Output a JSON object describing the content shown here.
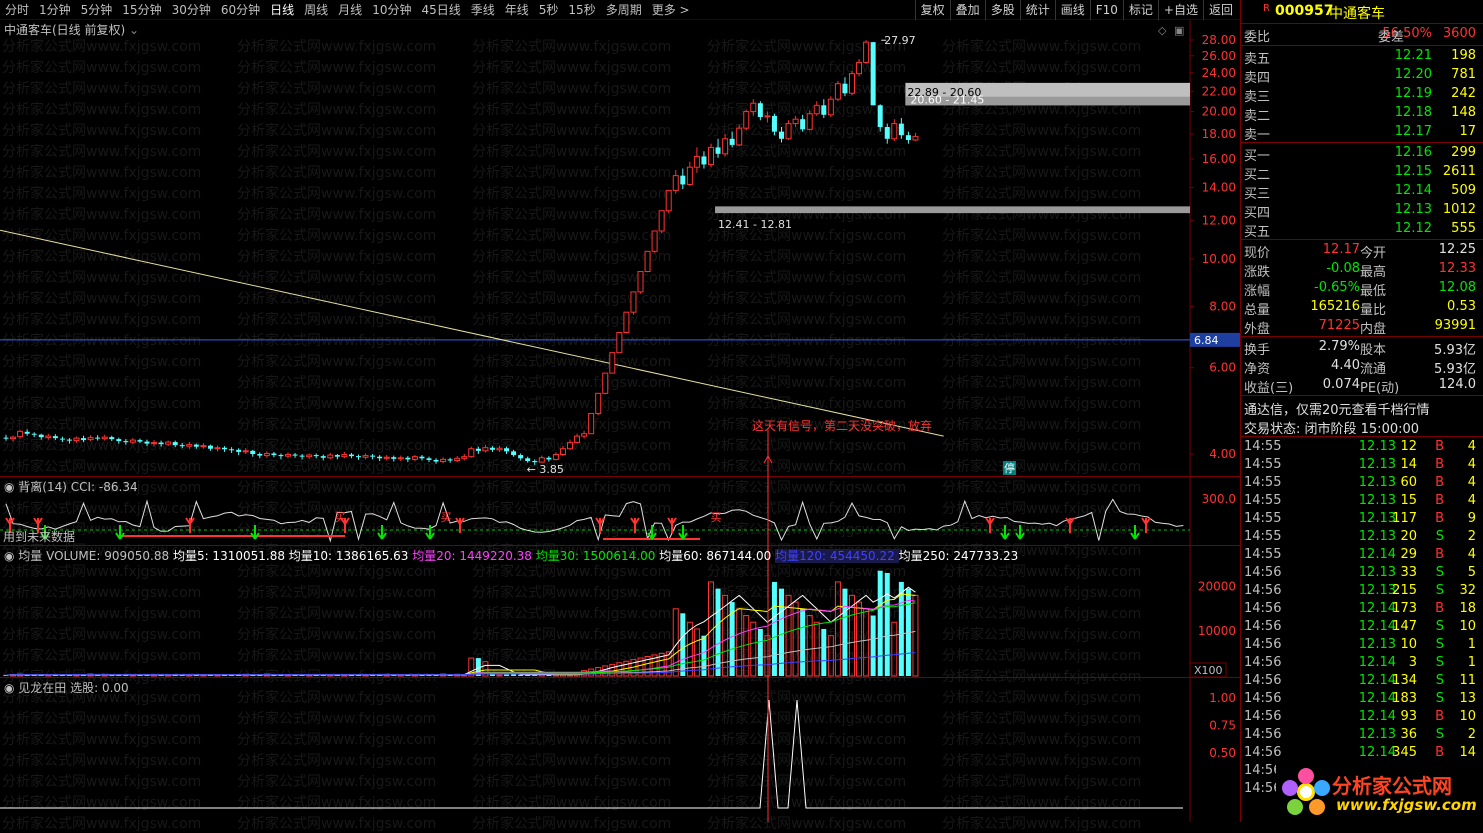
{
  "toolbar": {
    "periods": [
      "分时",
      "1分钟",
      "5分钟",
      "15分钟",
      "30分钟",
      "60分钟",
      "日线",
      "周线",
      "月线",
      "10分钟",
      "45日线",
      "季线",
      "年线",
      "5秒",
      "15秒",
      "多周期",
      "更多 >"
    ],
    "active_period": "日线",
    "tools": [
      "复权",
      "叠加",
      "多股",
      "统计",
      "画线",
      "F10",
      "标记",
      "+自选",
      "返回"
    ]
  },
  "main_chart": {
    "title": "中通客车(日线 前复权)",
    "y_axis": [
      "28.00",
      "26.00",
      "24.00",
      "22.00",
      "20.00",
      "18.00",
      "16.00",
      "14.00",
      "12.00",
      "10.00",
      "8.00",
      "6.00",
      "4.00"
    ],
    "current_price_tag": "6.84",
    "high_label": "27.97",
    "low_label": "3.85",
    "zone_upper_1": "22.89 - 20.60",
    "zone_upper_2": "20.60 - 21.45",
    "zone_lower": "12.41 - 12.81",
    "signal_note": "这天有信号，第二天没突破，放弃",
    "limit_badge": "停",
    "candles": [
      [
        4.32,
        4.3,
        4.38,
        4.26
      ],
      [
        4.3,
        4.33,
        4.36,
        4.24
      ],
      [
        4.34,
        4.45,
        4.48,
        4.3
      ],
      [
        4.44,
        4.4,
        4.49,
        4.36
      ],
      [
        4.4,
        4.38,
        4.43,
        4.33
      ],
      [
        4.38,
        4.33,
        4.4,
        4.28
      ],
      [
        4.32,
        4.35,
        4.4,
        4.28
      ],
      [
        4.35,
        4.31,
        4.39,
        4.27
      ],
      [
        4.3,
        4.28,
        4.34,
        4.23
      ],
      [
        4.28,
        4.26,
        4.31,
        4.2
      ],
      [
        4.26,
        4.31,
        4.34,
        4.22
      ],
      [
        4.31,
        4.27,
        4.36,
        4.23
      ],
      [
        4.28,
        4.32,
        4.37,
        4.25
      ],
      [
        4.32,
        4.3,
        4.37,
        4.26
      ],
      [
        4.3,
        4.33,
        4.38,
        4.26
      ],
      [
        4.33,
        4.29,
        4.36,
        4.25
      ],
      [
        4.29,
        4.25,
        4.32,
        4.2
      ],
      [
        4.25,
        4.23,
        4.29,
        4.18
      ],
      [
        4.23,
        4.27,
        4.31,
        4.19
      ],
      [
        4.27,
        4.24,
        4.3,
        4.21
      ],
      [
        4.24,
        4.2,
        4.28,
        4.15
      ],
      [
        4.2,
        4.22,
        4.27,
        4.15
      ],
      [
        4.22,
        4.19,
        4.26,
        4.14
      ],
      [
        4.19,
        4.23,
        4.26,
        4.15
      ],
      [
        4.23,
        4.17,
        4.26,
        4.13
      ],
      [
        4.17,
        4.15,
        4.21,
        4.11
      ],
      [
        4.15,
        4.18,
        4.23,
        4.1
      ],
      [
        4.18,
        4.14,
        4.2,
        4.1
      ],
      [
        4.14,
        4.16,
        4.21,
        4.1
      ],
      [
        4.16,
        4.1,
        4.18,
        4.06
      ],
      [
        4.1,
        4.12,
        4.16,
        4.05
      ],
      [
        4.12,
        4.09,
        4.15,
        4.04
      ],
      [
        4.09,
        4.08,
        4.13,
        4.02
      ],
      [
        4.08,
        4.04,
        4.11,
        3.98
      ],
      [
        4.04,
        4.06,
        4.11,
        4.0
      ],
      [
        4.06,
        4.0,
        4.08,
        3.95
      ],
      [
        4.0,
        3.97,
        4.03,
        3.92
      ],
      [
        3.97,
        4.01,
        4.05,
        3.93
      ],
      [
        4.01,
        3.98,
        4.04,
        3.94
      ],
      [
        3.98,
        3.96,
        4.01,
        3.9
      ],
      [
        3.96,
        3.99,
        4.03,
        3.92
      ],
      [
        3.99,
        3.97,
        4.02,
        3.93
      ],
      [
        3.97,
        3.95,
        4.0,
        3.9
      ],
      [
        3.95,
        3.98,
        4.01,
        3.91
      ],
      [
        3.98,
        3.96,
        4.01,
        3.92
      ],
      [
        3.96,
        3.93,
        3.99,
        3.88
      ],
      [
        3.93,
        3.98,
        4.02,
        3.9
      ],
      [
        3.98,
        3.95,
        4.0,
        3.9
      ],
      [
        3.95,
        3.99,
        4.04,
        3.92
      ],
      [
        3.99,
        3.96,
        4.02,
        3.92
      ],
      [
        3.96,
        3.94,
        3.99,
        3.89
      ],
      [
        3.94,
        3.97,
        4.01,
        3.9
      ],
      [
        3.97,
        3.95,
        4.0,
        3.9
      ],
      [
        3.95,
        3.92,
        3.98,
        3.87
      ],
      [
        3.92,
        3.94,
        3.98,
        3.88
      ],
      [
        3.94,
        3.91,
        3.97,
        3.86
      ],
      [
        3.91,
        3.93,
        3.97,
        3.87
      ],
      [
        3.93,
        3.9,
        3.96,
        3.85
      ],
      [
        3.9,
        3.95,
        3.98,
        3.87
      ],
      [
        3.95,
        3.92,
        3.98,
        3.88
      ],
      [
        3.92,
        3.89,
        3.95,
        3.85
      ],
      [
        3.89,
        3.86,
        3.92,
        3.82
      ],
      [
        3.86,
        3.9,
        3.94,
        3.83
      ],
      [
        3.9,
        3.88,
        3.93,
        3.84
      ],
      [
        3.88,
        3.92,
        3.96,
        3.85
      ],
      [
        3.92,
        3.95,
        4.0,
        3.88
      ],
      [
        3.95,
        4.1,
        4.14,
        3.93
      ],
      [
        4.1,
        4.06,
        4.14,
        4.0
      ],
      [
        4.06,
        4.12,
        4.18,
        4.03
      ],
      [
        4.12,
        4.08,
        4.15,
        4.04
      ],
      [
        4.08,
        4.11,
        4.16,
        4.04
      ],
      [
        4.11,
        4.05,
        4.14,
        4.0
      ],
      [
        4.05,
        3.98,
        4.08,
        3.95
      ],
      [
        3.98,
        3.92,
        4.01,
        3.88
      ],
      [
        3.92,
        3.87,
        3.95,
        3.84
      ],
      [
        3.87,
        3.85,
        3.9,
        3.8
      ],
      [
        3.85,
        3.93,
        3.97,
        3.84
      ],
      [
        3.93,
        3.9,
        3.96,
        3.86
      ],
      [
        3.9,
        3.99,
        4.03,
        3.88
      ],
      [
        3.99,
        4.1,
        4.15,
        3.96
      ],
      [
        4.1,
        4.22,
        4.28,
        4.08
      ],
      [
        4.22,
        4.35,
        4.4,
        4.2
      ],
      [
        4.35,
        4.4,
        4.46,
        4.3
      ],
      [
        4.4,
        4.84,
        4.84,
        4.4
      ],
      [
        4.84,
        5.32,
        5.32,
        4.8
      ],
      [
        5.32,
        5.85,
        5.85,
        5.3
      ],
      [
        5.85,
        6.44,
        6.44,
        5.85
      ],
      [
        6.44,
        7.08,
        7.08,
        6.44
      ],
      [
        7.08,
        7.79,
        7.79,
        7.08
      ],
      [
        7.79,
        8.57,
        8.57,
        7.7
      ],
      [
        8.57,
        9.43,
        9.43,
        8.5
      ],
      [
        9.43,
        10.37,
        10.37,
        9.4
      ],
      [
        10.37,
        11.41,
        11.41,
        10.3
      ],
      [
        11.41,
        12.55,
        12.55,
        11.3
      ],
      [
        12.55,
        13.81,
        13.81,
        12.4
      ],
      [
        13.81,
        14.8,
        15.19,
        13.6
      ],
      [
        14.8,
        14.2,
        15.3,
        13.9
      ],
      [
        14.2,
        15.4,
        15.8,
        14.1
      ],
      [
        15.4,
        16.2,
        16.9,
        15.0
      ],
      [
        16.2,
        15.6,
        16.6,
        15.3
      ],
      [
        15.6,
        16.9,
        17.2,
        15.4
      ],
      [
        16.9,
        16.4,
        17.6,
        16.1
      ],
      [
        16.4,
        17.6,
        18.0,
        16.2
      ],
      [
        17.6,
        17.1,
        18.2,
        16.9
      ],
      [
        17.1,
        18.5,
        18.8,
        17.0
      ],
      [
        18.5,
        20.0,
        20.2,
        18.3
      ],
      [
        20.0,
        20.8,
        21.2,
        19.6
      ],
      [
        20.8,
        19.5,
        21.0,
        19.2
      ],
      [
        19.5,
        19.6,
        20.0,
        19.0
      ],
      [
        19.6,
        18.2,
        19.8,
        17.9
      ],
      [
        18.2,
        17.6,
        18.6,
        17.3
      ],
      [
        17.6,
        18.9,
        19.2,
        17.5
      ],
      [
        18.9,
        19.3,
        19.6,
        18.6
      ],
      [
        19.3,
        18.4,
        19.7,
        18.2
      ],
      [
        18.4,
        19.8,
        20.1,
        18.3
      ],
      [
        19.8,
        20.6,
        21.0,
        19.6
      ],
      [
        20.6,
        19.7,
        21.2,
        19.4
      ],
      [
        19.7,
        21.2,
        21.5,
        19.5
      ],
      [
        21.2,
        22.8,
        23.1,
        21.0
      ],
      [
        22.8,
        21.8,
        23.5,
        21.5
      ],
      [
        21.8,
        23.9,
        24.2,
        21.6
      ],
      [
        23.9,
        25.2,
        25.6,
        23.6
      ],
      [
        25.2,
        27.72,
        27.97,
        25.0
      ],
      [
        27.72,
        20.6,
        27.72,
        20.6
      ],
      [
        20.6,
        18.6,
        20.7,
        18.2
      ],
      [
        18.6,
        17.6,
        18.9,
        17.2
      ],
      [
        17.6,
        18.9,
        19.3,
        17.4
      ],
      [
        18.9,
        17.9,
        19.4,
        17.6
      ],
      [
        17.9,
        17.5,
        18.2,
        17.2
      ],
      [
        17.5,
        17.8,
        18.1,
        17.4
      ]
    ],
    "trend_line": [
      [
        0,
        11.45
      ],
      [
        133,
        4.35
      ]
    ]
  },
  "cci": {
    "title": "背离(14)  CCI: -86.34",
    "y_tick": "300.0",
    "buy_label": "买",
    "future_note": "用到未来数据"
  },
  "volume": {
    "title": "均量",
    "labels": [
      "VOLUME: 909050.88",
      "均量5: 1310051.88",
      "均量10: 1386165.63",
      "均量20: 1449220.38",
      "均量30: 1500614.00",
      "均量60: 867144.00",
      "均量120: 454450.22",
      "均量250: 247733.23"
    ],
    "colors": [
      "#c0c0c0",
      "#ffffff",
      "#ffffff",
      "#ff40ff",
      "#00e600",
      "#ffffff",
      "#4040ff",
      "#ffffff"
    ],
    "y_axis": [
      "20000",
      "10000"
    ],
    "unit": "X100"
  },
  "jlzt": {
    "title": "见龙在田  选股: 0.00",
    "y_axis": [
      "1.00",
      "0.75",
      "0.50"
    ]
  },
  "quote": {
    "code": "000957",
    "name": "中通客车",
    "weibi_label": "委比",
    "weibi": "56.50%",
    "weicha_label": "委差",
    "weicha": "3600",
    "asks": [
      {
        "label": "卖五",
        "price": "12.21",
        "vol": "198"
      },
      {
        "label": "卖四",
        "price": "12.20",
        "vol": "781"
      },
      {
        "label": "卖三",
        "price": "12.19",
        "vol": "242"
      },
      {
        "label": "卖二",
        "price": "12.18",
        "vol": "148"
      },
      {
        "label": "卖一",
        "price": "12.17",
        "vol": "17"
      }
    ],
    "bids": [
      {
        "label": "买一",
        "price": "12.16",
        "vol": "299"
      },
      {
        "label": "买二",
        "price": "12.15",
        "vol": "2611"
      },
      {
        "label": "买三",
        "price": "12.14",
        "vol": "509"
      },
      {
        "label": "买四",
        "price": "12.13",
        "vol": "1012"
      },
      {
        "label": "买五",
        "price": "12.12",
        "vol": "555"
      }
    ],
    "stats": [
      {
        "l1": "现价",
        "v1": "12.17",
        "c1": "c-red",
        "l2": "今开",
        "v2": "12.25",
        "c2": "c-white"
      },
      {
        "l1": "涨跌",
        "v1": "-0.08",
        "c1": "c-green",
        "l2": "最高",
        "v2": "12.33",
        "c2": "c-red"
      },
      {
        "l1": "涨幅",
        "v1": "-0.65%",
        "c1": "c-green",
        "l2": "最低",
        "v2": "12.08",
        "c2": "c-green"
      },
      {
        "l1": "总量",
        "v1": "165216",
        "c1": "c-yellow",
        "l2": "量比",
        "v2": "0.53",
        "c2": "c-yellow"
      },
      {
        "l1": "外盘",
        "v1": "71225",
        "c1": "c-red",
        "l2": "内盘",
        "v2": "93991",
        "c2": "c-yellow"
      }
    ],
    "stats2": [
      {
        "l1": "换手",
        "v1": "2.79%",
        "l2": "股本",
        "v2": "5.93亿"
      },
      {
        "l1": "净资",
        "v1": "4.40",
        "l2": "流通",
        "v2": "5.93亿"
      },
      {
        "l1": "收益(三)",
        "v1": "0.074",
        "l2": "PE(动)",
        "v2": "124.0"
      }
    ],
    "promo": "通达信，仅需20元查看千档行情",
    "trade_status": "交易状态: 闭市阶段 15:00:00",
    "ticks": [
      [
        "14:55",
        "12.13",
        "12",
        "B",
        "4"
      ],
      [
        "14:55",
        "12.13",
        "14",
        "B",
        "4"
      ],
      [
        "14:55",
        "12.13",
        "60",
        "B",
        "4"
      ],
      [
        "14:55",
        "12.13",
        "15",
        "B",
        "4"
      ],
      [
        "14:55",
        "12.13",
        "117",
        "B",
        "9"
      ],
      [
        "14:55",
        "12.13",
        "20",
        "S",
        "2"
      ],
      [
        "14:55",
        "12.14",
        "29",
        "B",
        "4"
      ],
      [
        "14:56",
        "12.13",
        "33",
        "S",
        "5"
      ],
      [
        "14:56",
        "12.13",
        "215",
        "S",
        "32"
      ],
      [
        "14:56",
        "12.14",
        "173",
        "B",
        "18"
      ],
      [
        "14:56",
        "12.14",
        "147",
        "S",
        "10"
      ],
      [
        "14:56",
        "12.13",
        "10",
        "S",
        "1"
      ],
      [
        "14:56",
        "12.14",
        "3",
        "S",
        "1"
      ],
      [
        "14:56",
        "12.14",
        "134",
        "S",
        "11"
      ],
      [
        "14:56",
        "12.14",
        "183",
        "S",
        "13"
      ],
      [
        "14:56",
        "12.14",
        "93",
        "B",
        "10"
      ],
      [
        "14:56",
        "12.13",
        "36",
        "S",
        "2"
      ],
      [
        "14:56",
        "12.14",
        "345",
        "B",
        "14"
      ],
      [
        "14:56",
        "",
        "",
        " ",
        ""
      ],
      [
        "14:56",
        "",
        "",
        " ",
        ""
      ]
    ],
    "logo_title": "分析家公式网",
    "logo_url": "www.fxjgsw.com",
    "watermark": "分析家公式网www.fxjgsw.com"
  }
}
